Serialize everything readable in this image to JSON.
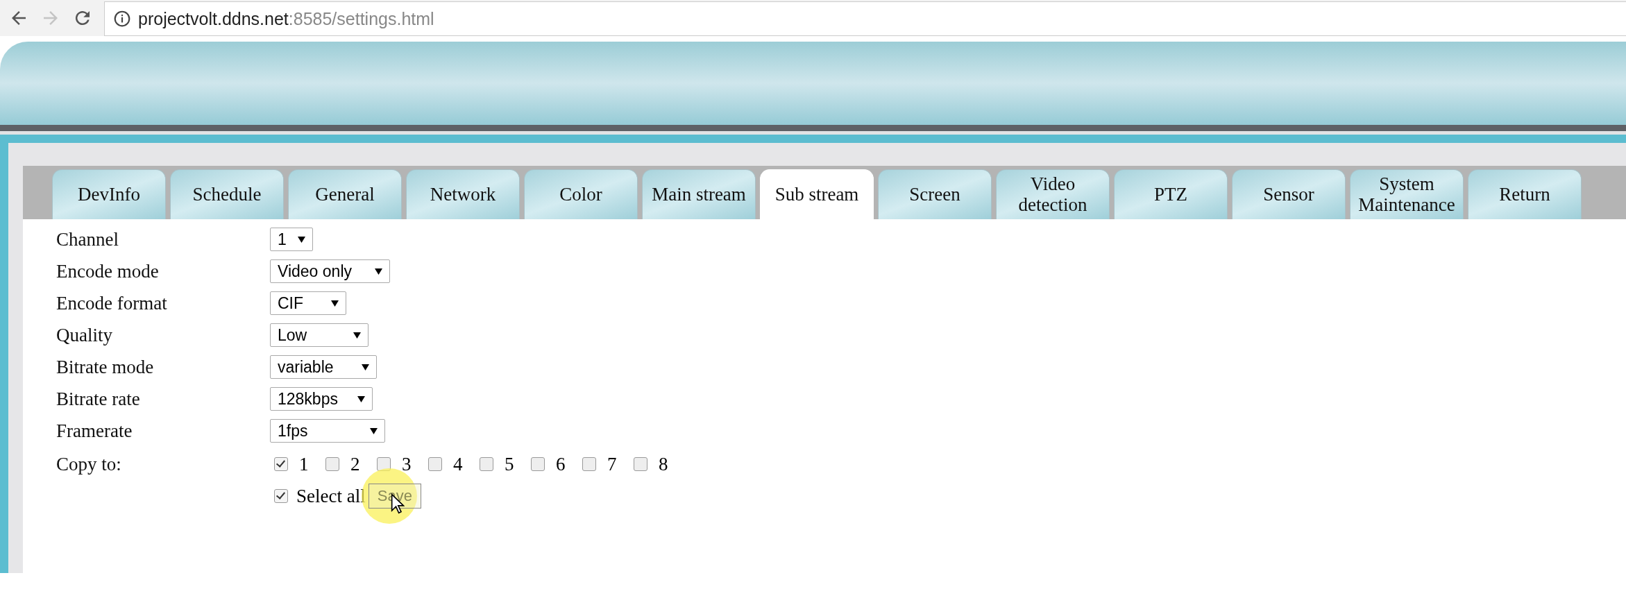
{
  "browser": {
    "host": "projectvolt.ddns.net",
    "path": ":8585/settings.html"
  },
  "tabs": [
    {
      "label": "DevInfo",
      "selected": false
    },
    {
      "label": "Schedule",
      "selected": false
    },
    {
      "label": "General",
      "selected": false
    },
    {
      "label": "Network",
      "selected": false
    },
    {
      "label": "Color",
      "selected": false
    },
    {
      "label": "Main stream",
      "selected": false
    },
    {
      "label": "Sub stream",
      "selected": true
    },
    {
      "label": "Screen",
      "selected": false
    },
    {
      "label": "Video detection",
      "selected": false
    },
    {
      "label": "PTZ",
      "selected": false
    },
    {
      "label": "Sensor",
      "selected": false
    },
    {
      "label": "System Maintenance",
      "selected": false
    },
    {
      "label": "Return",
      "selected": false
    }
  ],
  "fields": [
    {
      "label": "Channel",
      "value": "1"
    },
    {
      "label": "Encode mode",
      "value": "Video only"
    },
    {
      "label": "Encode format",
      "value": "CIF"
    },
    {
      "label": "Quality",
      "value": "Low"
    },
    {
      "label": "Bitrate mode",
      "value": "variable"
    },
    {
      "label": "Bitrate rate",
      "value": "128kbps"
    },
    {
      "label": "Framerate",
      "value": "1fps"
    }
  ],
  "copy_to": {
    "label": "Copy to:",
    "channels": [
      {
        "label": "1",
        "checked": true
      },
      {
        "label": "2",
        "checked": false
      },
      {
        "label": "3",
        "checked": false
      },
      {
        "label": "4",
        "checked": false
      },
      {
        "label": "5",
        "checked": false
      },
      {
        "label": "6",
        "checked": false
      },
      {
        "label": "7",
        "checked": false
      },
      {
        "label": "8",
        "checked": false
      }
    ]
  },
  "select_all": {
    "label": "Select all",
    "checked": true
  },
  "save_button": "Save"
}
